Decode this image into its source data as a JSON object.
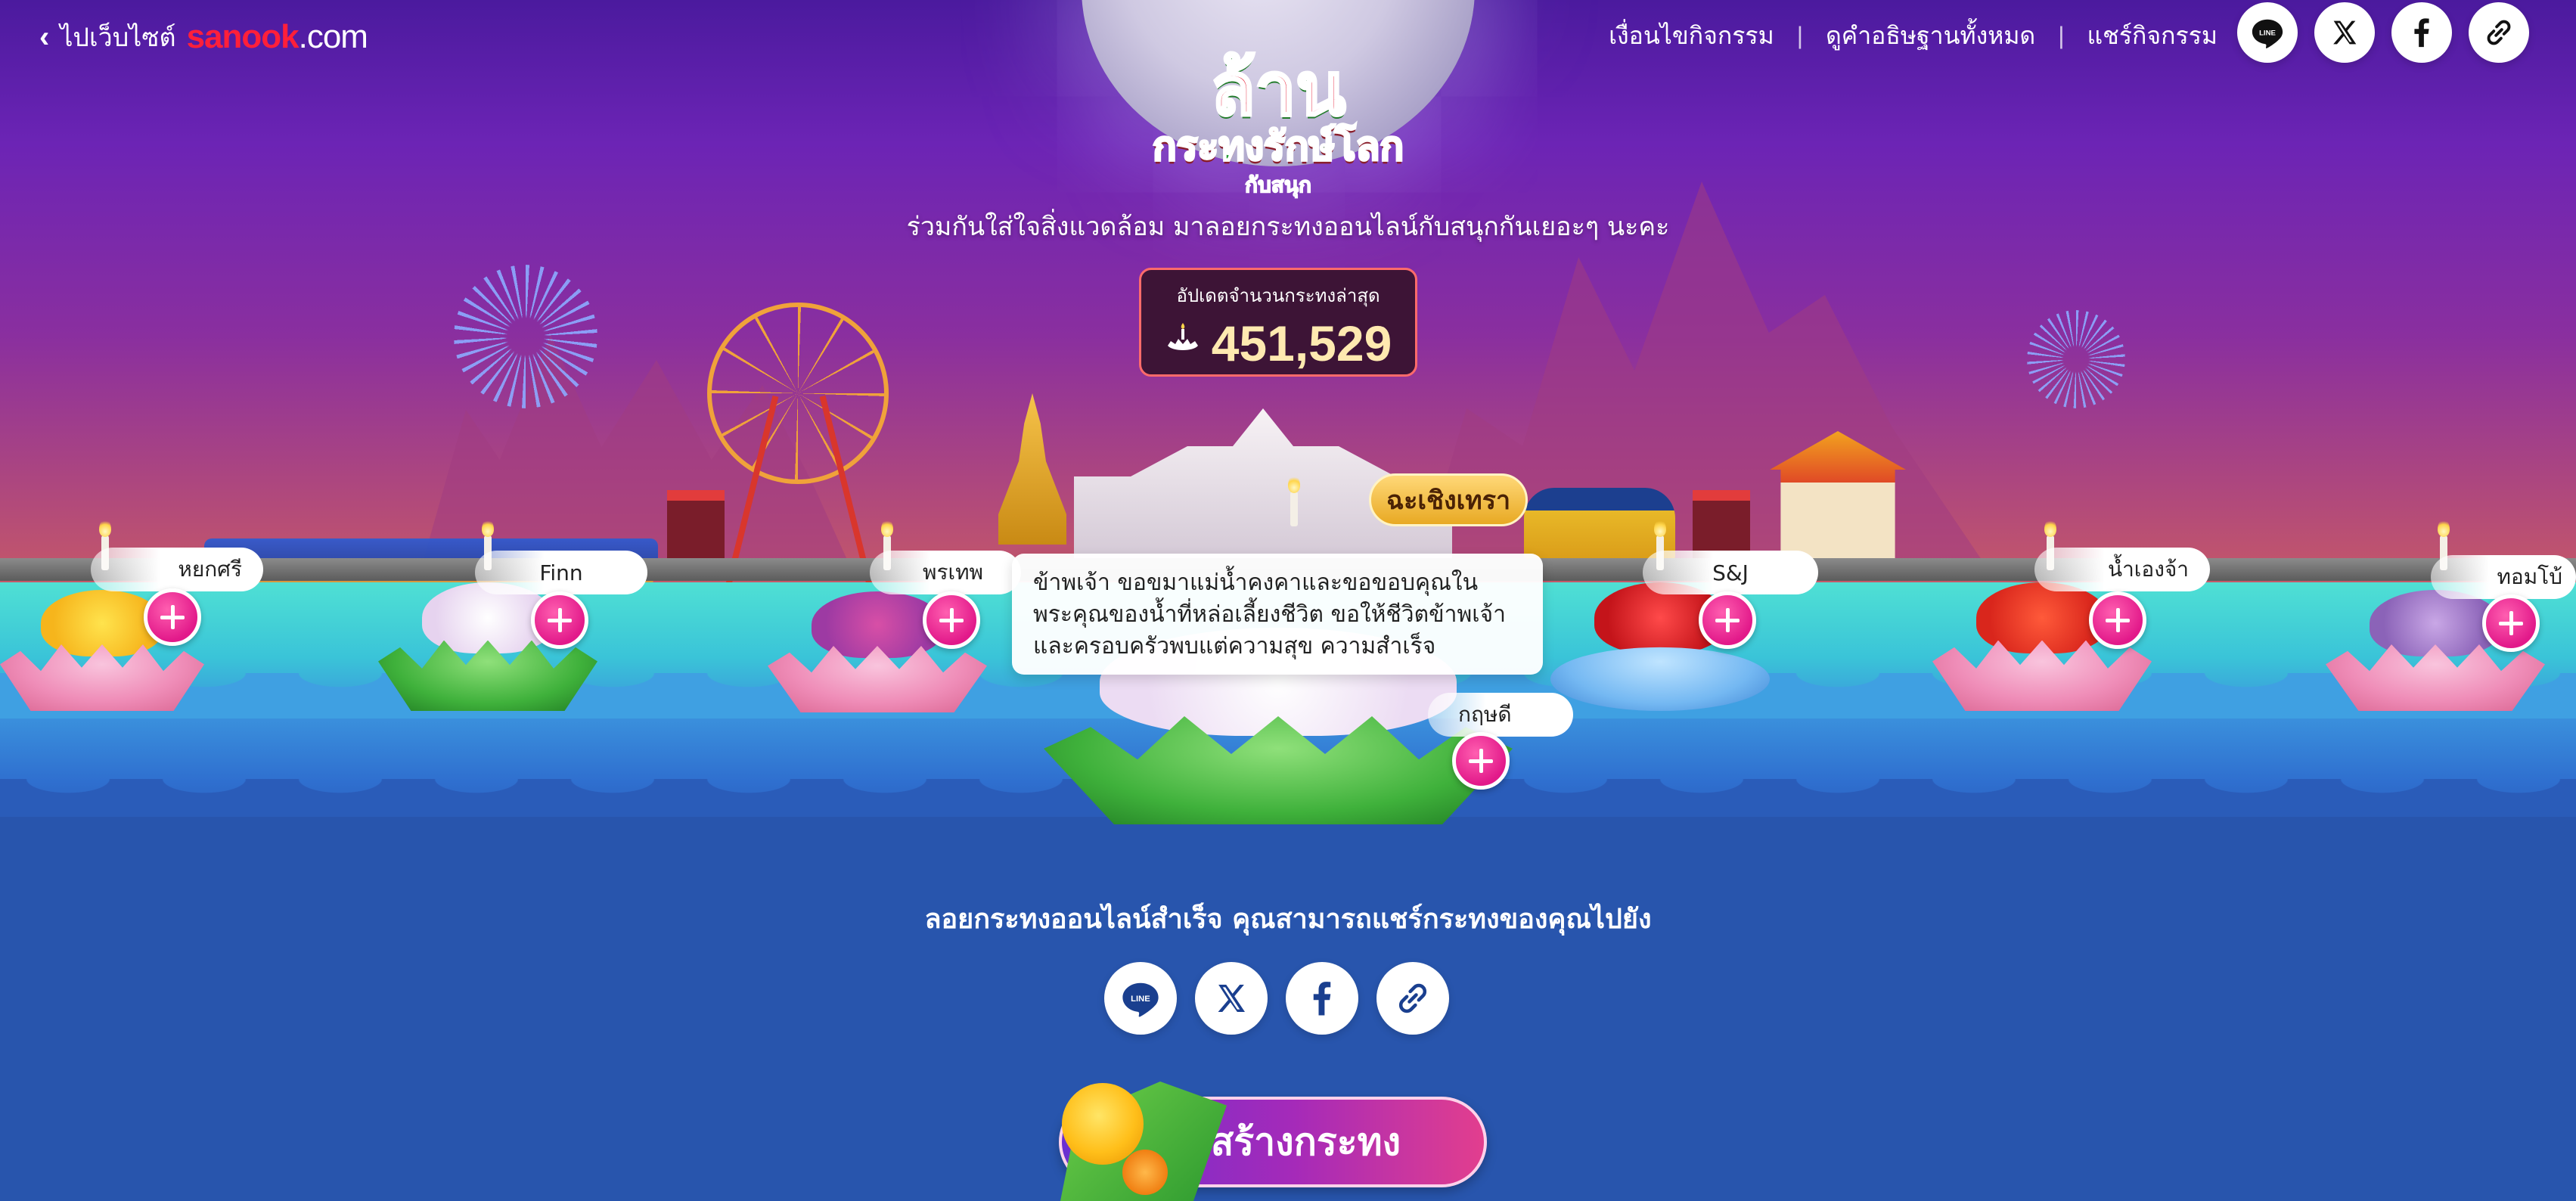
{
  "nav": {
    "back_label": "ไปเว็บไซต์",
    "brand_main": "sanook",
    "brand_suffix": ".com",
    "links": [
      "เงื่อนไขกิจกรรม",
      "ดูคำอธิษฐานทั้งหมด",
      "แชร์กิจกรรม"
    ],
    "separator": "|"
  },
  "share_icons": [
    "line-icon",
    "x-icon",
    "facebook-icon",
    "link-icon"
  ],
  "share_line_label": "LINE",
  "logo": {
    "main": "ล้าน",
    "sub": "กระทงรักษ์โลก",
    "tiny": "กับสนุก"
  },
  "tagline": "ร่วมกันใส่ใจสิ่งแวดล้อม มาลอยกระทงออนไลน์กับสนุกกันเยอะๆ นะคะ",
  "counter": {
    "label": "อัปเดตจำนวนกระทงล่าสุด",
    "value": "451,529",
    "icon": "krathong-icon"
  },
  "krathongs": [
    {
      "name": "หยกศรี",
      "style": "pink-yellow"
    },
    {
      "name": "Finn",
      "style": "green-white"
    },
    {
      "name": "พรเทพ",
      "style": "pink-purple"
    },
    {
      "name": "กฤษดี",
      "style": "green-white-large"
    },
    {
      "name": "S&J",
      "style": "blue-red"
    },
    {
      "name": "น้ำเองจ้า",
      "style": "pink-red"
    },
    {
      "name": "ทอมโบ้",
      "style": "pink-lilac"
    }
  ],
  "featured": {
    "badge": "ฉะเชิงเทรา",
    "wish": "ข้าพเจ้า ขอขมาแม่น้ำคงคาและขอขอบคุณในพระคุณของน้ำที่หล่อเลี้ยงชีวิต ขอให้ชีวิตข้าพเจ้าและครอบครัวพบแต่ความสุข ความสำเร็จ"
  },
  "share_section": {
    "title": "ลอยกระทงออนไลน์สำเร็จ คุณสามารถแชร์กระทงของคุณไปยัง"
  },
  "create_button": "สร้างกระทง",
  "colors": {
    "brand_red": "#ff1f3a",
    "plus_pink": "#e2198a",
    "water_top": "#4fe0d4",
    "ocean": "#2855ad"
  }
}
